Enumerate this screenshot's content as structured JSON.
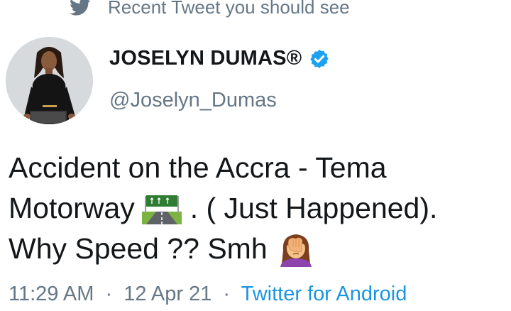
{
  "context": {
    "icon": "twitter-bird-icon",
    "text": "Recent Tweet you should see"
  },
  "author": {
    "display_name": "JOSELYN DUMAS®",
    "handle": "@Joselyn_Dumas",
    "verified": true,
    "verified_icon": "verified-badge-icon"
  },
  "tweet": {
    "line1": "Accident on the Accra - Tema",
    "line2_before": "Motorway",
    "line2_after": ". ( Just Happened).",
    "line3": "Why Speed ?? Smh",
    "emoji_motorway": "motorway-emoji",
    "emoji_facepalm": "woman-facepalming-emoji"
  },
  "meta": {
    "time": "11:29 AM",
    "separator": "·",
    "date": "12 Apr 21",
    "source": "Twitter for Android"
  },
  "colors": {
    "text_primary": "#14171a",
    "text_secondary": "#657786",
    "link": "#1b95e0",
    "verified": "#1da1f2"
  }
}
